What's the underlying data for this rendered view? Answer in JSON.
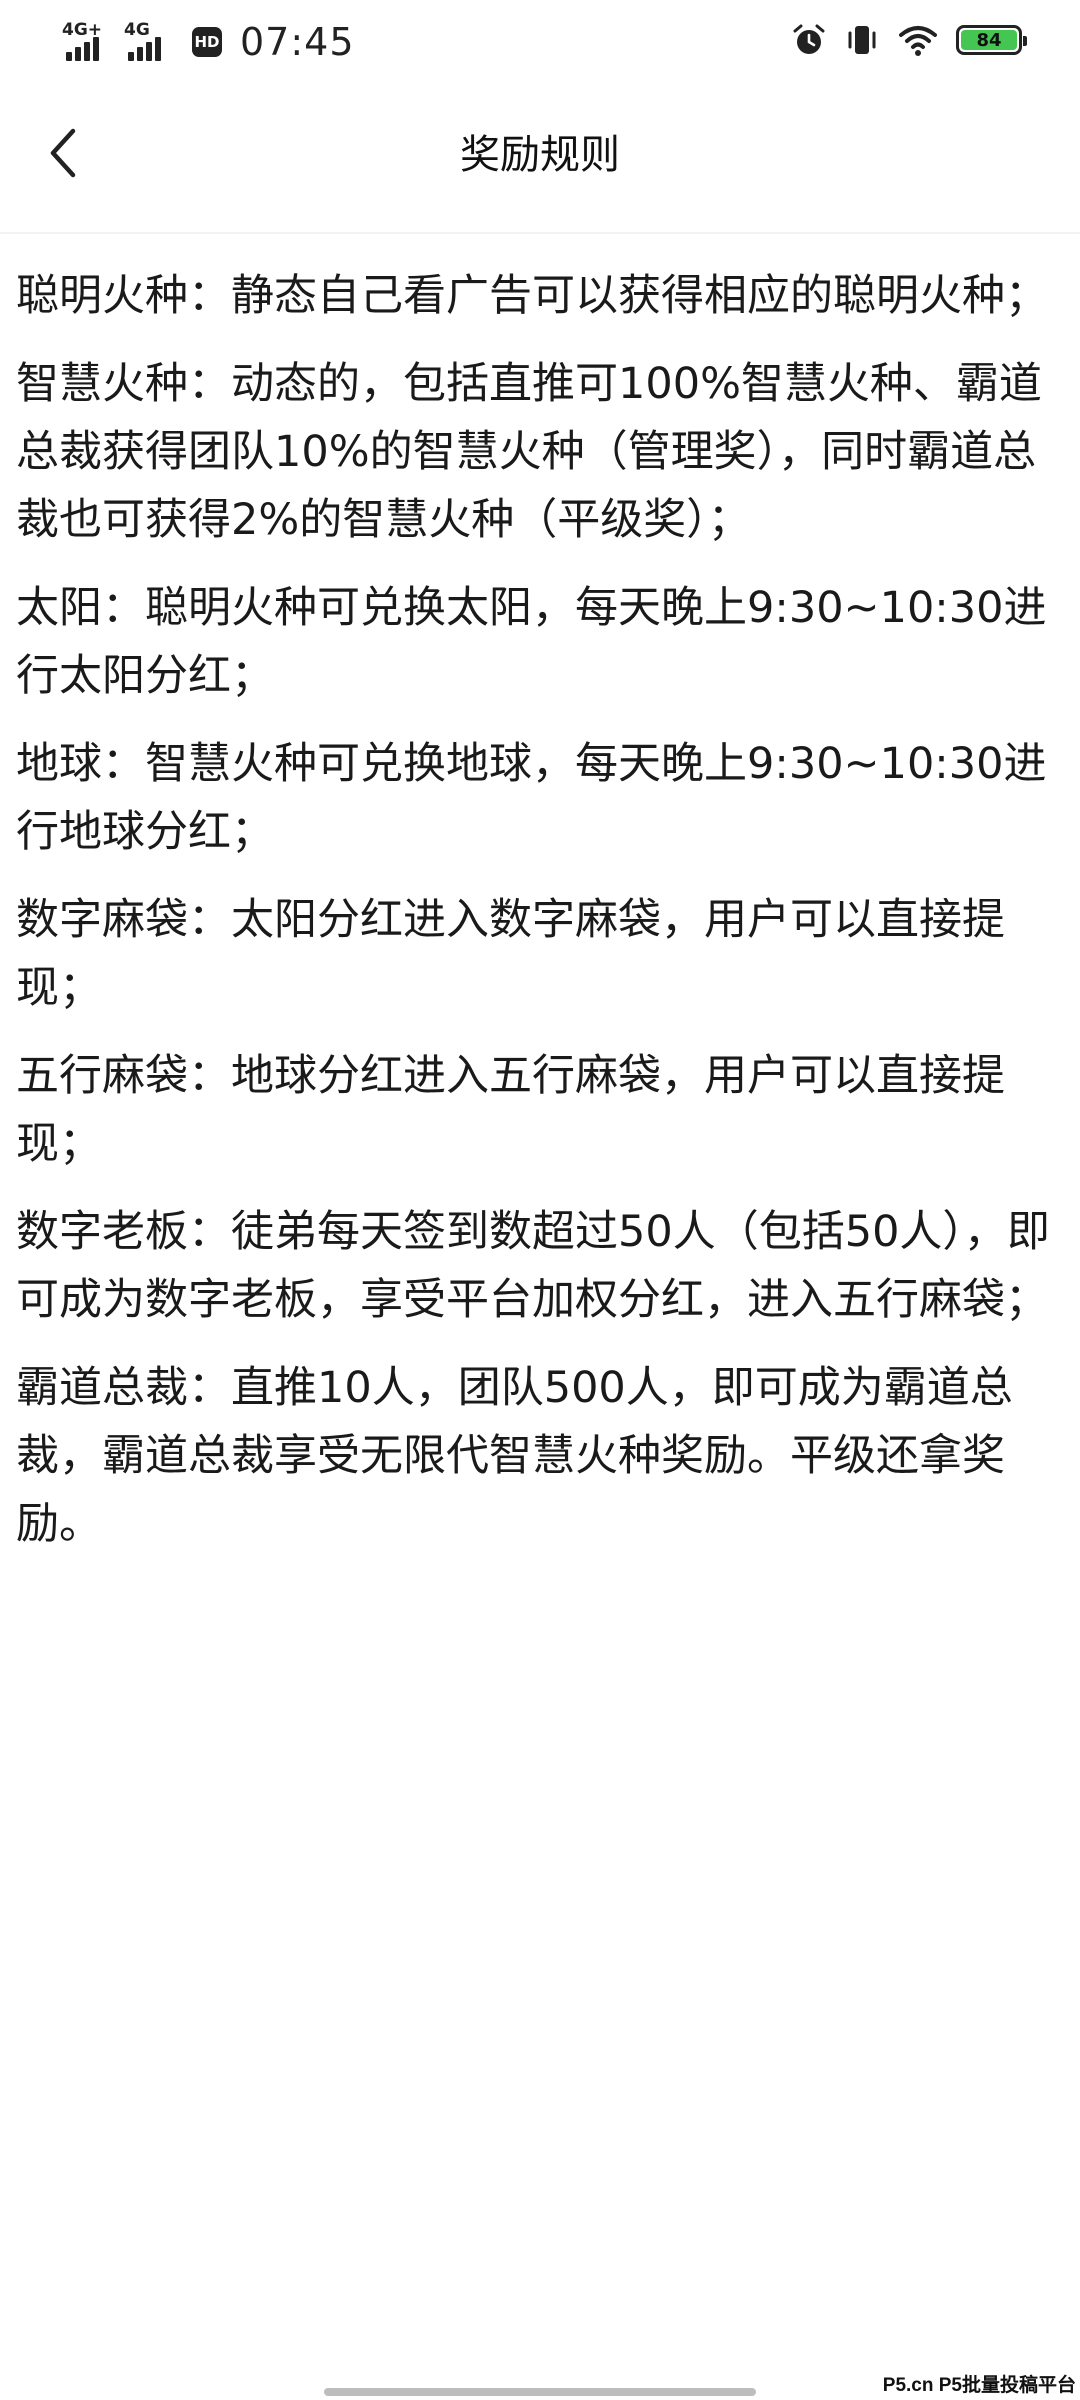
{
  "status_bar": {
    "network_1": "4G+",
    "network_2": "4G",
    "hd_badge": "HD",
    "time": "07:45",
    "battery_level": "84",
    "icons": [
      "signal-icon",
      "hd-icon",
      "alarm-icon",
      "vibrate-icon",
      "wifi-icon",
      "battery-icon"
    ]
  },
  "header": {
    "title": "奖励规则",
    "back_icon": "back-chevron-icon"
  },
  "rules": [
    "聪明火种：静态自己看广告可以获得相应的聪明火种；",
    "智慧火种：动态的，包括直推可100%智慧火种、霸道总裁获得团队10%的智慧火种（管理奖），同时霸道总裁也可获得2%的智慧火种（平级奖）；",
    "太阳：聪明火种可兑换太阳，每天晚上9:30~10:30进行太阳分红；",
    "地球：智慧火种可兑换地球，每天晚上9:30~10:30进行地球分红；",
    "数字麻袋：太阳分红进入数字麻袋，用户可以直接提现；",
    "五行麻袋：地球分红进入五行麻袋，用户可以直接提现；",
    "数字老板：徒弟每天签到数超过50人（包括50人），即可成为数字老板，享受平台加权分红，进入五行麻袋；",
    "霸道总裁：直推10人，团队500人，即可成为霸道总裁，霸道总裁享受无限代智慧火种奖励。平级还拿奖励。"
  ],
  "watermark": "P5.cn P5批量投稿平台",
  "colors": {
    "battery_fill": "#45c552",
    "text": "#1a1a1a",
    "background": "#ffffff"
  }
}
